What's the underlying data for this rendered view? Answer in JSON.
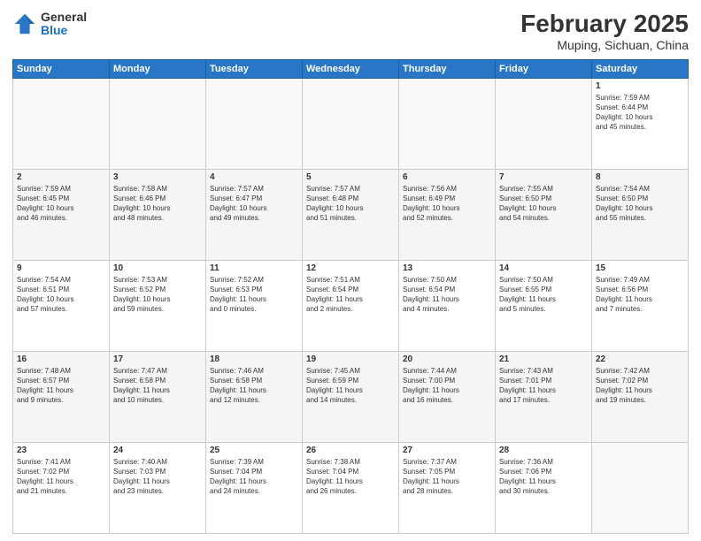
{
  "header": {
    "logo_general": "General",
    "logo_blue": "Blue",
    "title": "February 2025",
    "subtitle": "Muping, Sichuan, China"
  },
  "days_of_week": [
    "Sunday",
    "Monday",
    "Tuesday",
    "Wednesday",
    "Thursday",
    "Friday",
    "Saturday"
  ],
  "weeks": [
    {
      "id": "week0",
      "days": [
        {
          "num": "",
          "info": ""
        },
        {
          "num": "",
          "info": ""
        },
        {
          "num": "",
          "info": ""
        },
        {
          "num": "",
          "info": ""
        },
        {
          "num": "",
          "info": ""
        },
        {
          "num": "",
          "info": ""
        },
        {
          "num": "1",
          "info": "Sunrise: 7:59 AM\nSunset: 6:44 PM\nDaylight: 10 hours\nand 45 minutes."
        }
      ]
    },
    {
      "id": "week1",
      "days": [
        {
          "num": "2",
          "info": "Sunrise: 7:59 AM\nSunset: 6:45 PM\nDaylight: 10 hours\nand 46 minutes."
        },
        {
          "num": "3",
          "info": "Sunrise: 7:58 AM\nSunset: 6:46 PM\nDaylight: 10 hours\nand 48 minutes."
        },
        {
          "num": "4",
          "info": "Sunrise: 7:57 AM\nSunset: 6:47 PM\nDaylight: 10 hours\nand 49 minutes."
        },
        {
          "num": "5",
          "info": "Sunrise: 7:57 AM\nSunset: 6:48 PM\nDaylight: 10 hours\nand 51 minutes."
        },
        {
          "num": "6",
          "info": "Sunrise: 7:56 AM\nSunset: 6:49 PM\nDaylight: 10 hours\nand 52 minutes."
        },
        {
          "num": "7",
          "info": "Sunrise: 7:55 AM\nSunset: 6:50 PM\nDaylight: 10 hours\nand 54 minutes."
        },
        {
          "num": "8",
          "info": "Sunrise: 7:54 AM\nSunset: 6:50 PM\nDaylight: 10 hours\nand 55 minutes."
        }
      ]
    },
    {
      "id": "week2",
      "days": [
        {
          "num": "9",
          "info": "Sunrise: 7:54 AM\nSunset: 6:51 PM\nDaylight: 10 hours\nand 57 minutes."
        },
        {
          "num": "10",
          "info": "Sunrise: 7:53 AM\nSunset: 6:52 PM\nDaylight: 10 hours\nand 59 minutes."
        },
        {
          "num": "11",
          "info": "Sunrise: 7:52 AM\nSunset: 6:53 PM\nDaylight: 11 hours\nand 0 minutes."
        },
        {
          "num": "12",
          "info": "Sunrise: 7:51 AM\nSunset: 6:54 PM\nDaylight: 11 hours\nand 2 minutes."
        },
        {
          "num": "13",
          "info": "Sunrise: 7:50 AM\nSunset: 6:54 PM\nDaylight: 11 hours\nand 4 minutes."
        },
        {
          "num": "14",
          "info": "Sunrise: 7:50 AM\nSunset: 6:55 PM\nDaylight: 11 hours\nand 5 minutes."
        },
        {
          "num": "15",
          "info": "Sunrise: 7:49 AM\nSunset: 6:56 PM\nDaylight: 11 hours\nand 7 minutes."
        }
      ]
    },
    {
      "id": "week3",
      "days": [
        {
          "num": "16",
          "info": "Sunrise: 7:48 AM\nSunset: 6:57 PM\nDaylight: 11 hours\nand 9 minutes."
        },
        {
          "num": "17",
          "info": "Sunrise: 7:47 AM\nSunset: 6:58 PM\nDaylight: 11 hours\nand 10 minutes."
        },
        {
          "num": "18",
          "info": "Sunrise: 7:46 AM\nSunset: 6:58 PM\nDaylight: 11 hours\nand 12 minutes."
        },
        {
          "num": "19",
          "info": "Sunrise: 7:45 AM\nSunset: 6:59 PM\nDaylight: 11 hours\nand 14 minutes."
        },
        {
          "num": "20",
          "info": "Sunrise: 7:44 AM\nSunset: 7:00 PM\nDaylight: 11 hours\nand 16 minutes."
        },
        {
          "num": "21",
          "info": "Sunrise: 7:43 AM\nSunset: 7:01 PM\nDaylight: 11 hours\nand 17 minutes."
        },
        {
          "num": "22",
          "info": "Sunrise: 7:42 AM\nSunset: 7:02 PM\nDaylight: 11 hours\nand 19 minutes."
        }
      ]
    },
    {
      "id": "week4",
      "days": [
        {
          "num": "23",
          "info": "Sunrise: 7:41 AM\nSunset: 7:02 PM\nDaylight: 11 hours\nand 21 minutes."
        },
        {
          "num": "24",
          "info": "Sunrise: 7:40 AM\nSunset: 7:03 PM\nDaylight: 11 hours\nand 23 minutes."
        },
        {
          "num": "25",
          "info": "Sunrise: 7:39 AM\nSunset: 7:04 PM\nDaylight: 11 hours\nand 24 minutes."
        },
        {
          "num": "26",
          "info": "Sunrise: 7:38 AM\nSunset: 7:04 PM\nDaylight: 11 hours\nand 26 minutes."
        },
        {
          "num": "27",
          "info": "Sunrise: 7:37 AM\nSunset: 7:05 PM\nDaylight: 11 hours\nand 28 minutes."
        },
        {
          "num": "28",
          "info": "Sunrise: 7:36 AM\nSunset: 7:06 PM\nDaylight: 11 hours\nand 30 minutes."
        },
        {
          "num": "",
          "info": ""
        }
      ]
    }
  ]
}
